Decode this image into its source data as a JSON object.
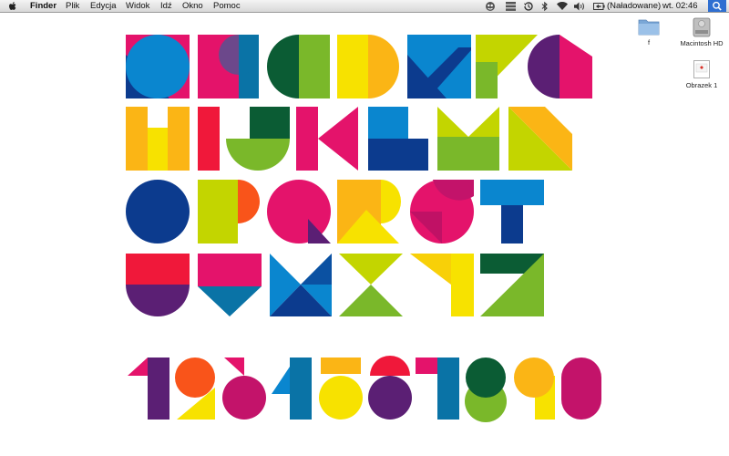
{
  "menubar": {
    "apple_icon": "apple-logo-icon",
    "app_name": "Finder",
    "menus": [
      "Plik",
      "Edycja",
      "Widok",
      "Idź",
      "Okno",
      "Pomoc"
    ],
    "status_icons": [
      "user-status-icon",
      "spaces-icon",
      "time-machine-icon",
      "bluetooth-icon",
      "wifi-icon",
      "volume-icon"
    ],
    "battery_label": "(Naładowane)",
    "clock": "wt. 02:46",
    "spotlight_icon": "spotlight-search-icon"
  },
  "desktop": {
    "items": [
      {
        "label": "f",
        "icon": "folder-icon"
      },
      {
        "label": "Macintosh HD",
        "icon": "hard-drive-icon"
      },
      {
        "label": "Obrazek 1",
        "icon": "image-file-icon"
      }
    ]
  },
  "wallpaper": {
    "description_colors": {
      "blue": "#0a86cf",
      "navy": "#0c3b8e",
      "magenta": "#e4136b",
      "teal": "#0a73a6",
      "green": "#0b5c34",
      "lime": "#7ab82a",
      "yellow": "#f7e200",
      "orange": "#fbb515",
      "purple": "#5b1f74",
      "red": "#f0183a",
      "olive": "#c3d500"
    }
  }
}
